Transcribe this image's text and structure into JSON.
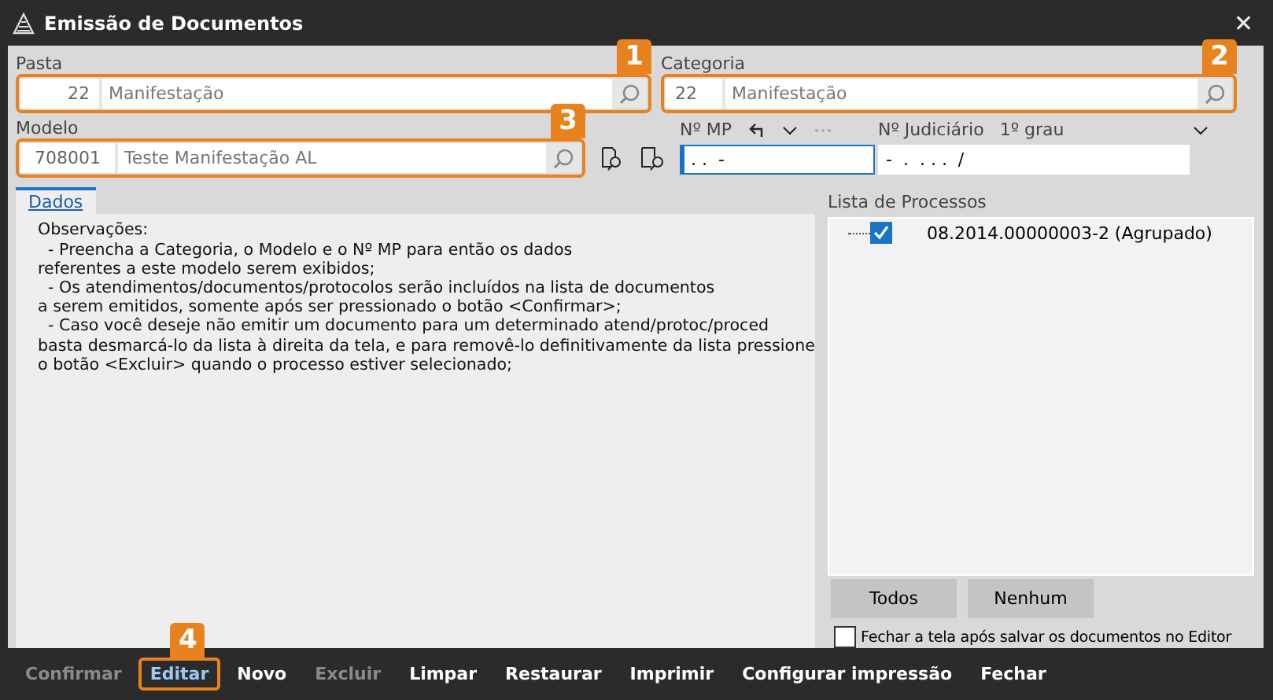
{
  "window": {
    "title": "Emissão de Documentos",
    "close": "✕"
  },
  "pasta": {
    "label": "Pasta",
    "code": "22",
    "name": "Manifestação",
    "callout": "1"
  },
  "categoria": {
    "label": "Categoria",
    "code": "22",
    "name": "Manifestação",
    "callout": "2"
  },
  "modelo": {
    "label": "Modelo",
    "code": "708001",
    "name": "Teste Manifestação AL",
    "callout": "3"
  },
  "nr_mp": {
    "label": "Nº MP",
    "value": ". .  -",
    "focused": true
  },
  "nr_judiciario": {
    "label": "Nº Judiciário",
    "grau": "1º grau",
    "value": "-  .  . . .  /"
  },
  "tabs": [
    {
      "label": "Dados",
      "selected": true
    }
  ],
  "observacoes": [
    "Observações:",
    "  - Preencha a Categoria, o Modelo e o Nº MP para então os dados",
    "referentes a este modelo serem exibidos;",
    "  - Os atendimentos/documentos/protocolos serão incluídos na lista de documentos",
    "a serem emitidos, somente após ser pressionado o botão <Confirmar>;",
    "  - Caso você deseje não emitir um documento para um determinado atend/protoc/proced",
    "basta desmarcá-lo da lista à direita da tela, e para removê-lo definitivamente da lista pressione",
    "o botão <Excluir> quando o processo estiver selecionado;"
  ],
  "processos": {
    "label": "Lista de Processos",
    "items": [
      {
        "label": "08.2014.00000003-2 (Agrupado)",
        "checked": true
      }
    ]
  },
  "list_buttons": [
    "Todos",
    "Nenhum"
  ],
  "close_after_save": {
    "label": "Fechar a tela após salvar os documentos no Editor",
    "checked": false
  },
  "toolbar": [
    {
      "label": "Confirmar",
      "disabled": true
    },
    {
      "label": "Editar",
      "disabled": false,
      "highlighted": true,
      "callout": "4"
    },
    {
      "label": "Novo",
      "disabled": false
    },
    {
      "label": "Excluir",
      "disabled": true
    },
    {
      "label": "Limpar",
      "disabled": false
    },
    {
      "label": "Restaurar",
      "disabled": false
    },
    {
      "label": "Imprimir",
      "disabled": false
    },
    {
      "label": "Configurar impressão",
      "disabled": false
    },
    {
      "label": "Fechar",
      "disabled": false
    }
  ]
}
